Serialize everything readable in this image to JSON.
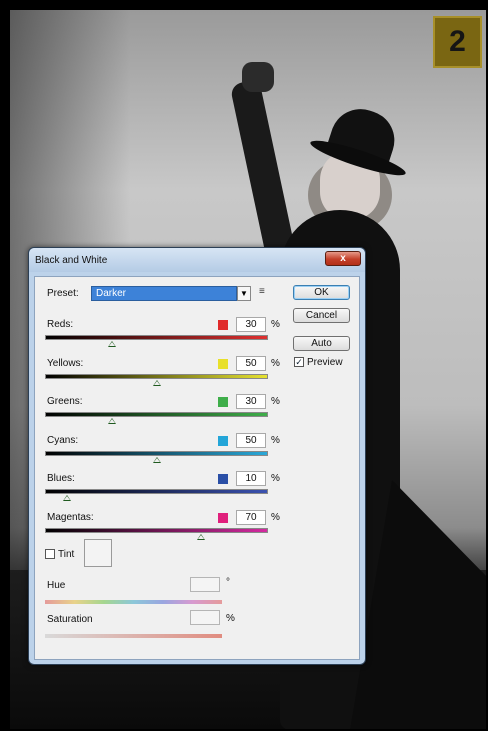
{
  "badge": {
    "number": "2"
  },
  "dialog": {
    "title": "Black and White",
    "close_label": "x",
    "preset": {
      "label": "Preset:",
      "value": "Darker"
    },
    "buttons": {
      "ok": "OK",
      "cancel": "Cancel",
      "auto": "Auto"
    },
    "preview": {
      "label": "Preview",
      "checked": true
    },
    "sliders": [
      {
        "label": "Reds:",
        "value": "30",
        "unit": "%",
        "color": "#e02a2a",
        "fraction": 0.3
      },
      {
        "label": "Yellows:",
        "value": "50",
        "unit": "%",
        "color": "#e8e02a",
        "fraction": 0.5
      },
      {
        "label": "Greens:",
        "value": "30",
        "unit": "%",
        "color": "#3fae4a",
        "fraction": 0.3
      },
      {
        "label": "Cyans:",
        "value": "50",
        "unit": "%",
        "color": "#23a5d8",
        "fraction": 0.5
      },
      {
        "label": "Blues:",
        "value": "10",
        "unit": "%",
        "color": "#2a4fa6",
        "fraction": 0.1
      },
      {
        "label": "Magentas:",
        "value": "70",
        "unit": "%",
        "color": "#e0207c",
        "fraction": 0.7
      }
    ],
    "tint": {
      "label": "Tint",
      "checked": false
    },
    "hue": {
      "label": "Hue",
      "unit": "°"
    },
    "saturation": {
      "label": "Saturation",
      "unit": "%"
    }
  }
}
